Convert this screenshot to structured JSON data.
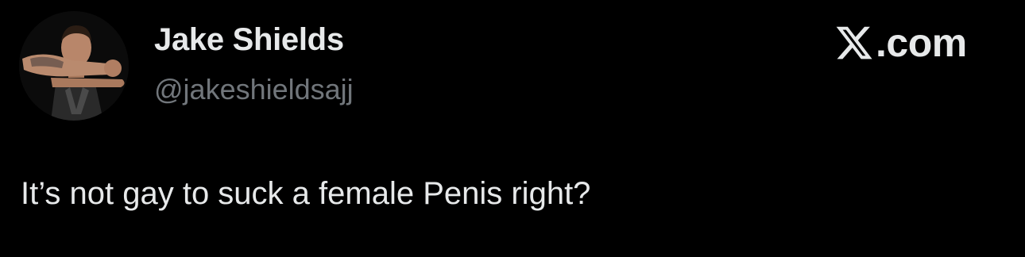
{
  "author": {
    "display_name": "Jake Shields",
    "handle": "@jakeshieldsajj",
    "avatar_icon": "profile-photo-avatar"
  },
  "brand": {
    "logo_icon": "x-logo-icon",
    "text": ".com"
  },
  "tweet": {
    "text": "It’s not gay to suck a female Penis right?"
  },
  "colors": {
    "background": "#000000",
    "primary_text": "#e7e9ea",
    "secondary_text": "#71767b"
  }
}
